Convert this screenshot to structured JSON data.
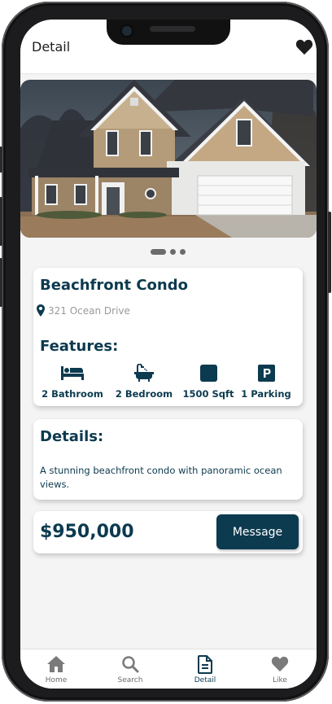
{
  "header": {
    "title": "Detail",
    "favorite_icon": "heart-icon"
  },
  "gallery": {
    "image": "house-photo",
    "page_count": 3,
    "active_index": 0
  },
  "property": {
    "name": "Beachfront Condo",
    "address": "321 Ocean Drive",
    "features_title": "Features:",
    "features": [
      {
        "icon": "bed-icon",
        "label": "2 Bathroom"
      },
      {
        "icon": "bathtub-icon",
        "label": "2 Bedroom"
      },
      {
        "icon": "square-icon",
        "label": "1500 Sqft"
      },
      {
        "icon": "parking-icon",
        "label": "1 Parking"
      }
    ],
    "details_title": "Details:",
    "description": "A stunning beachfront condo with panoramic ocean views.",
    "price": "$950,000",
    "message_label": "Message"
  },
  "tabs": [
    {
      "icon": "home-icon",
      "label": "Home",
      "active": false
    },
    {
      "icon": "search-icon",
      "label": "Search",
      "active": false
    },
    {
      "icon": "document-icon",
      "label": "Detail",
      "active": true
    },
    {
      "icon": "heart-icon",
      "label": "Like",
      "active": false
    }
  ],
  "colors": {
    "primary": "#0c3a4f",
    "muted": "#9a9a9a",
    "background": "#f4f4f5"
  }
}
